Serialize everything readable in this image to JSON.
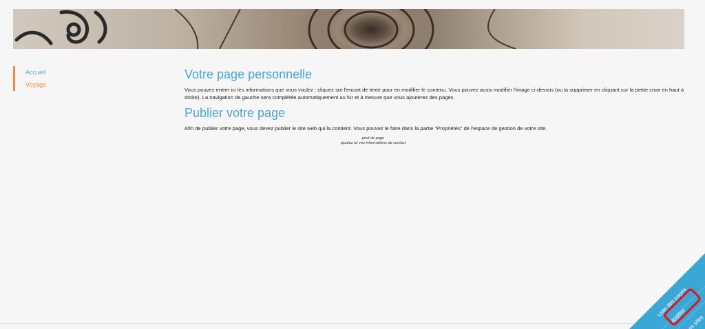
{
  "nav": {
    "items": [
      {
        "label": "Accueil",
        "active": false
      },
      {
        "label": "Voyage",
        "active": true
      }
    ]
  },
  "main": {
    "title": "Votre page personnelle",
    "paragraph": "Vous pouvez entrer ici les informations que vous voulez : cliquez sur l'encart de texte pour en modifier le contenu. Vous pouvez aussi modifier l'image ci-dessus (ou la supprimer en cliquant sur la petite croix en haut à droite). La navigation de gauche sera complétée automatiquement au fur et à mesure que vous ajouterez des pages.",
    "publish_title": "Publier votre page",
    "publish_paragraph": "Afin de publier votre page, vous devez publier le site web qui la contient. Vous pouvez le faire dans la partie \"Propriétés\" de l'espace de gestion de votre site."
  },
  "footer": {
    "line1": "pied de page",
    "line2": "ajoutez ici vos informations de contact"
  },
  "corner_menu": {
    "liste_label": "Liste des pages",
    "modifier_label": "Modifier",
    "sites_label": "Les sites"
  },
  "colors": {
    "accent_blue": "#4aa6cf",
    "accent_orange": "#f08a3c",
    "highlight_red": "#e2121b",
    "corner_blue": "#3aa7d6"
  }
}
